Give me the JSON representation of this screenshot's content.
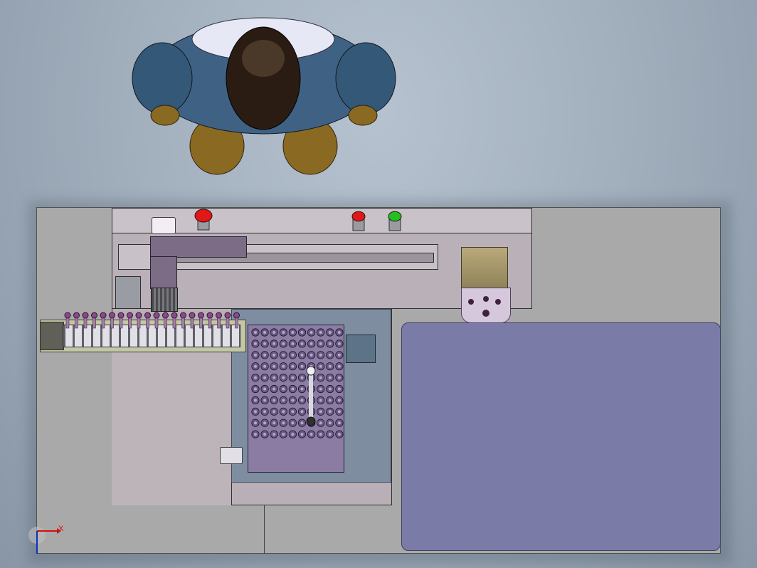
{
  "viewport": {
    "title": ""
  },
  "triad": {
    "x_label": "X",
    "x_color": "#d01010",
    "z_color": "#1030c0"
  },
  "buttons": [
    {
      "name": "red-emergency-button",
      "color": "#e01818"
    },
    {
      "name": "red-stop-button",
      "color": "#e01818"
    },
    {
      "name": "green-start-button",
      "color": "#22c020"
    }
  ],
  "colors": {
    "background": "#a2afbd",
    "base_plate": "#a8a8a8",
    "machine_frame": "#b4adb4",
    "table_plate": "#7a7aa8",
    "tray": "#7f7098",
    "worker_suit": "#3a5a78"
  },
  "tray": {
    "rows": 10,
    "cols": 10
  },
  "feeder": {
    "slots": 20
  }
}
